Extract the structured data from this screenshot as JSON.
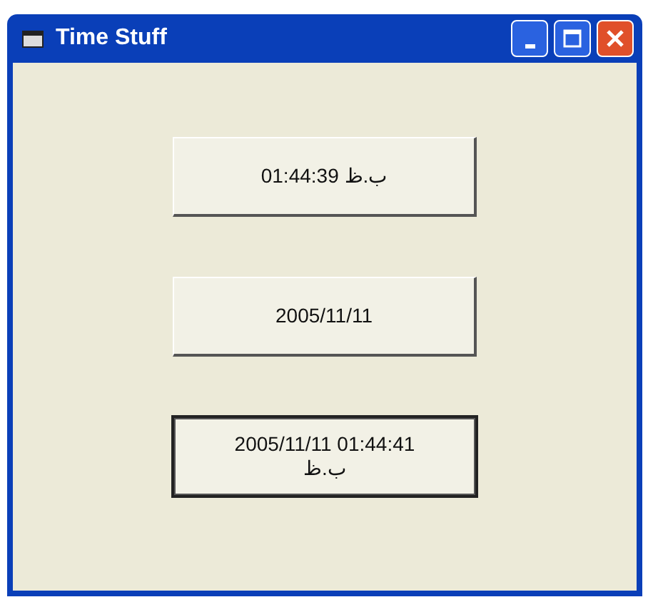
{
  "window": {
    "title": "Time Stuff"
  },
  "buttons": [
    {
      "label": "01:44:39 ب.ظ",
      "focused": false
    },
    {
      "label": "2005/11/11",
      "focused": false
    },
    {
      "label": "2005/11/11 01:44:41 ب.ظ",
      "focused": true
    }
  ]
}
